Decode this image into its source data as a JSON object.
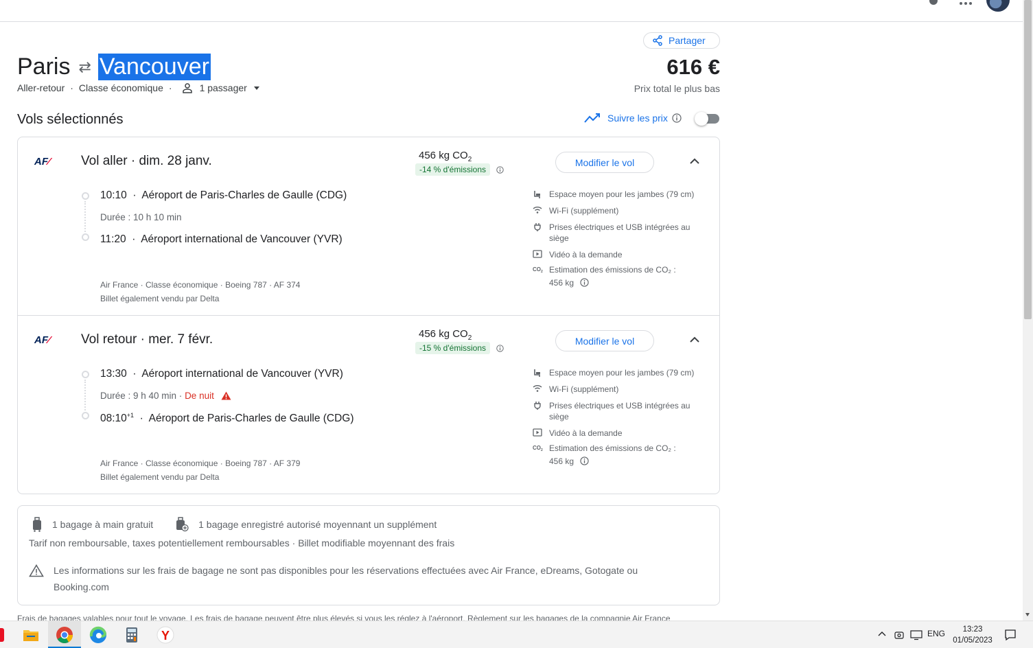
{
  "header": {
    "share_label": "Partager"
  },
  "route": {
    "origin": "Paris",
    "destination": "Vancouver",
    "swap_icon": "swap-arrows-icon"
  },
  "trip": {
    "type": "Aller-retour",
    "cabin": "Classe économique",
    "passengers": "1 passager"
  },
  "price": {
    "amount": "616 €",
    "label": "Prix total le plus bas"
  },
  "section": {
    "title": "Vols sélectionnés",
    "track_label": "Suivre les prix",
    "track_enabled": false
  },
  "legs": [
    {
      "title": "Vol aller · dim. 28 janv.",
      "airline_logo": "AF",
      "co2": "456 kg CO",
      "co2_sub": "2",
      "emissions": "-14 % d'émissions",
      "modify_label": "Modifier le vol",
      "dep_time": "10:10",
      "dep_airport": "Aéroport de Paris-Charles de Gaulle (CDG)",
      "duration": "Durée : 10 h 10 min",
      "arr_time": "11:20",
      "arr_airport": "Aéroport international de Vancouver (YVR)",
      "details": "Air France · Classe économique · Boeing 787 · AF 374",
      "sold_by": "Billet également vendu par Delta",
      "amenities": {
        "legroom": "Espace moyen pour les jambes (79 cm)",
        "wifi": "Wi-Fi (supplément)",
        "power": "Prises électriques et USB intégrées au siège",
        "video": "Vidéo à la demande",
        "co2": "Estimation des émissions de CO₂ :",
        "co2_value": "456 kg"
      }
    },
    {
      "title": "Vol retour · mer. 7 févr.",
      "airline_logo": "AF",
      "co2": "456 kg CO",
      "co2_sub": "2",
      "emissions": "-15 % d'émissions",
      "modify_label": "Modifier le vol",
      "dep_time": "13:30",
      "dep_airport": "Aéroport international de Vancouver (YVR)",
      "duration": "Durée : 9 h 40 min · ",
      "overnight": "De nuit",
      "arr_time": "08:10",
      "arr_plus": "+1",
      "arr_airport": "Aéroport de Paris-Charles de Gaulle (CDG)",
      "details": "Air France · Classe économique · Boeing 787 · AF 379",
      "sold_by": "Billet également vendu par Delta",
      "amenities": {
        "legroom": "Espace moyen pour les jambes (79 cm)",
        "wifi": "Wi-Fi (supplément)",
        "power": "Prises électriques et USB intégrées au siège",
        "video": "Vidéo à la demande",
        "co2": "Estimation des émissions de CO₂ :",
        "co2_value": "456 kg"
      }
    }
  ],
  "baggage": {
    "carry_on": "1 bagage à main gratuit",
    "checked": "1 bagage enregistré autorisé moyennant un supplément",
    "fare_rules": "Tarif non remboursable, taxes potentiellement remboursables · Billet modifiable moyennant des frais",
    "warning": "Les informations sur les frais de bagage ne sont pas disponibles pour les réservations effectuées avec Air France, eDreams, Gotogate ou Booking.com"
  },
  "footnote": "Frais de bagages valables pour tout le voyage. Les frais de bagage peuvent être plus élevés si vous les réglez à l'aéroport. Règlement sur les bagages de la compagnie Air France",
  "taskbar": {
    "lang": "ENG",
    "time": "13:23",
    "date": "01/05/2023"
  },
  "colors": {
    "accent": "#1a73e8",
    "emissions_bg": "#e6f4ea",
    "emissions_text": "#137333",
    "overnight": "#d93025"
  }
}
